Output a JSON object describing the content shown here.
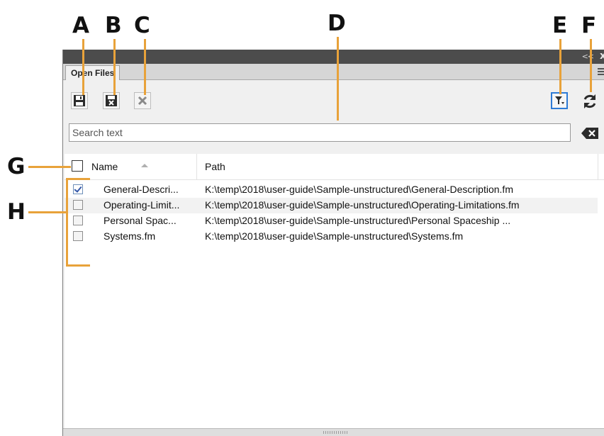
{
  "callouts": {
    "a": "A",
    "b": "B",
    "c": "C",
    "d": "D",
    "e": "E",
    "f": "F",
    "g": "G",
    "h": "H"
  },
  "panel": {
    "tab_label": "Open Files",
    "collapse_glyph": "<<",
    "close_glyph": "x"
  },
  "toolbar": {
    "icons": [
      "save-icon",
      "save-close-icon",
      "close-icon",
      "filter-icon",
      "refresh-icon"
    ],
    "accent": "#2e7bd6"
  },
  "search": {
    "placeholder": "Search text"
  },
  "table": {
    "columns": [
      "Name",
      "Path"
    ],
    "rows": [
      {
        "checked": true,
        "name": "General-Descri...",
        "path": "K:\\temp\\2018\\user-guide\\Sample-unstructured\\General-Description.fm"
      },
      {
        "checked": false,
        "name": "Operating-Limit...",
        "path": "K:\\temp\\2018\\user-guide\\Sample-unstructured\\Operating-Limitations.fm"
      },
      {
        "checked": false,
        "name": "Personal Spac...",
        "path": "K:\\temp\\2018\\user-guide\\Sample-unstructured\\Personal Spaceship ..."
      },
      {
        "checked": false,
        "name": "Systems.fm",
        "path": "K:\\temp\\2018\\user-guide\\Sample-unstructured\\Systems.fm"
      }
    ]
  },
  "colors": {
    "callout_line": "#e8a23a",
    "titlebar": "#4c4c4c"
  }
}
